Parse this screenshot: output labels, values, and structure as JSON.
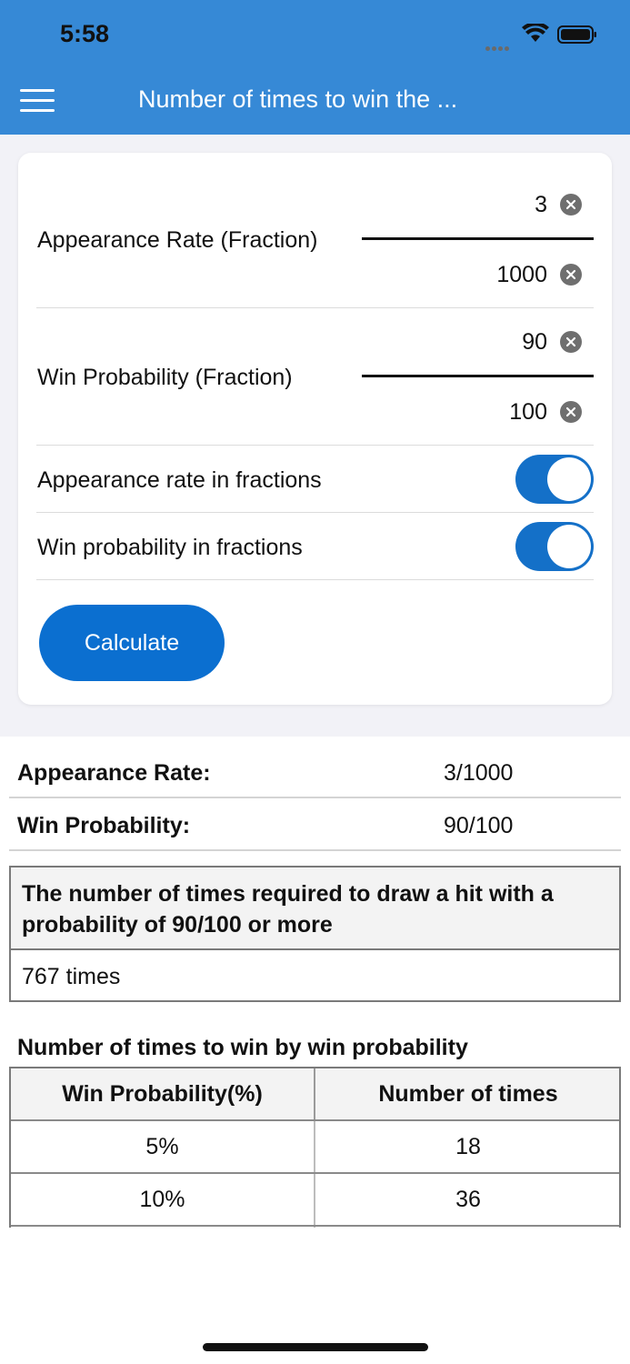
{
  "status_bar": {
    "time": "5:58"
  },
  "header": {
    "title": "Number of times to win the ..."
  },
  "form": {
    "appearance_rate_label": "Appearance Rate (Fraction)",
    "appearance_numerator": "3",
    "appearance_denominator": "1000",
    "win_probability_label": "Win Probability (Fraction)",
    "win_numerator": "90",
    "win_denominator": "100",
    "toggle_appearance_label": "Appearance rate in fractions",
    "toggle_appearance_on": true,
    "toggle_win_label": "Win probability in fractions",
    "toggle_win_on": true,
    "calculate_label": "Calculate"
  },
  "results": {
    "appearance_rate_label": "Appearance Rate:",
    "appearance_rate_value": "3/1000",
    "win_probability_label": "Win Probability:",
    "win_probability_value": "90/100",
    "required_heading": "The number of times required to draw a hit with a probability of 90/100 or more",
    "required_value": "767 times"
  },
  "probability_table": {
    "title": "Number of times to win by win probability",
    "headers": [
      "Win Probability(%)",
      "Number of times"
    ],
    "rows": [
      [
        "5%",
        "18"
      ],
      [
        "10%",
        "36"
      ]
    ]
  },
  "colors": {
    "header": "#3689d6",
    "accent": "#0b6fd0",
    "toggle_on": "#1470c8"
  }
}
